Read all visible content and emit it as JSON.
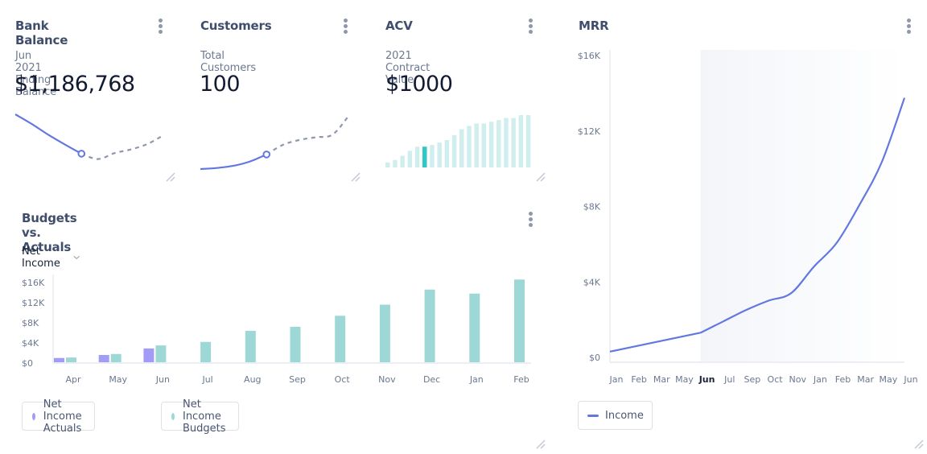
{
  "cards": {
    "bank": {
      "title": "Bank Balance",
      "subtitle": "Jun 2021 Ending Balance",
      "value": "$1,186,768",
      "sparkline": {
        "actual": [
          100,
          82,
          62,
          44,
          27
        ],
        "forecast": [
          27,
          17,
          28,
          35,
          45,
          62
        ],
        "marker_index": 4
      }
    },
    "customers": {
      "title": "Customers",
      "subtitle": "Total Customers",
      "value": "100",
      "sparkline": {
        "actual": [
          0,
          2,
          6,
          14,
          27
        ],
        "forecast": [
          27,
          45,
          54,
          59,
          64,
          100
        ],
        "marker_index": 4
      }
    },
    "acv": {
      "title": "ACV",
      "subtitle": "2021 Contract Value",
      "value": "$1000",
      "bars": [
        12,
        18,
        28,
        40,
        50,
        50,
        54,
        60,
        66,
        78,
        92,
        100,
        106,
        106,
        110,
        114,
        119,
        119,
        126,
        126
      ],
      "highlight_index": 5
    }
  },
  "budgets": {
    "title": "Budgets vs. Actuals",
    "metric_select": "Net Income",
    "legend": [
      {
        "label": "Net Income Actuals",
        "color": "#a39cf6"
      },
      {
        "label": "Net Income Budgets",
        "color": "#9dd8d6"
      }
    ]
  },
  "mrr": {
    "title": "MRR",
    "legend_label": "Income",
    "legend_color": "#6278e0",
    "highlight_label": "Jun"
  },
  "chart_data": [
    {
      "type": "bar",
      "title": "Budgets vs. Actuals",
      "categories": [
        "Apr",
        "May",
        "Jun",
        "Jul",
        "Aug",
        "Sep",
        "Oct",
        "Nov",
        "Dec",
        "Jan",
        "Feb"
      ],
      "series": [
        {
          "name": "Net Income Actuals",
          "color": "#a39cf6",
          "values": [
            1000,
            1600,
            2900,
            null,
            null,
            null,
            null,
            null,
            null,
            null,
            null
          ]
        },
        {
          "name": "Net Income Budgets",
          "color": "#9dd8d6",
          "values": [
            1100,
            1800,
            3500,
            4200,
            6400,
            7200,
            9400,
            11600,
            14600,
            13800,
            16600
          ]
        }
      ],
      "yticks": [
        "$0",
        "$4K",
        "$8K",
        "$12K",
        "$16K"
      ],
      "ytick_values": [
        0,
        4000,
        8000,
        12000,
        16000
      ],
      "ylim": [
        0,
        16000
      ],
      "grid": false,
      "legend": "bottom-left"
    },
    {
      "type": "line",
      "title": "MRR",
      "categories": [
        "Jan",
        "Feb",
        "Mar",
        "May",
        "Jun",
        "Jul",
        "Sep",
        "Oct",
        "Nov",
        "Jan",
        "Feb",
        "Mar",
        "May",
        "Jun"
      ],
      "series": [
        {
          "name": "Income",
          "color": "#6278e0",
          "values": [
            350,
            600,
            850,
            1100,
            1350,
            1950,
            2550,
            3050,
            3450,
            4850,
            6100,
            8100,
            10400,
            13800
          ]
        }
      ],
      "yticks": [
        "$0",
        "$4K",
        "$8K",
        "$12K",
        "$16K"
      ],
      "ytick_values": [
        0,
        4000,
        8000,
        12000,
        16000
      ],
      "ylim": [
        0,
        16000
      ],
      "forecast_start": "Jun",
      "grid": false,
      "legend": "bottom-left"
    }
  ]
}
